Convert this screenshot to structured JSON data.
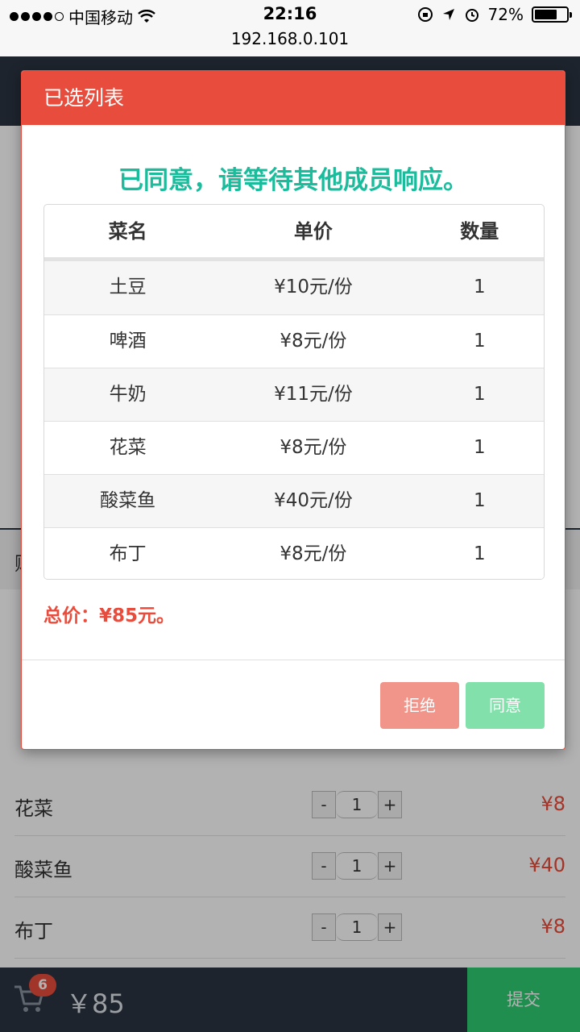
{
  "status_bar": {
    "carrier": "中国移动",
    "time": "22:16",
    "url": "192.168.0.101",
    "battery": "72%",
    "battery_level": 0.72
  },
  "background": {
    "section_label": "购",
    "rows": [
      {
        "name": "花菜",
        "qty": "1",
        "price": "¥8"
      },
      {
        "name": "酸菜鱼",
        "qty": "1",
        "price": "¥40"
      },
      {
        "name": "布丁",
        "qty": "1",
        "price": "¥8"
      }
    ],
    "qty_minus": "-",
    "qty_plus": "+",
    "cart_count": "6",
    "cart_total": "￥85",
    "submit_label": "提交"
  },
  "modal": {
    "title": "已选列表",
    "message": "已同意，请等待其他成员响应。",
    "columns": [
      "菜名",
      "单价",
      "数量"
    ],
    "items": [
      {
        "name": "土豆",
        "price": "¥10元/份",
        "qty": "1"
      },
      {
        "name": "啤酒",
        "price": "¥8元/份",
        "qty": "1"
      },
      {
        "name": "牛奶",
        "price": "¥11元/份",
        "qty": "1"
      },
      {
        "name": "花菜",
        "price": "¥8元/份",
        "qty": "1"
      },
      {
        "name": "酸菜鱼",
        "price": "¥40元/份",
        "qty": "1"
      },
      {
        "name": "布丁",
        "price": "¥8元/份",
        "qty": "1"
      }
    ],
    "total": "总价：¥85元。",
    "reject_label": "拒绝",
    "agree_label": "同意"
  }
}
